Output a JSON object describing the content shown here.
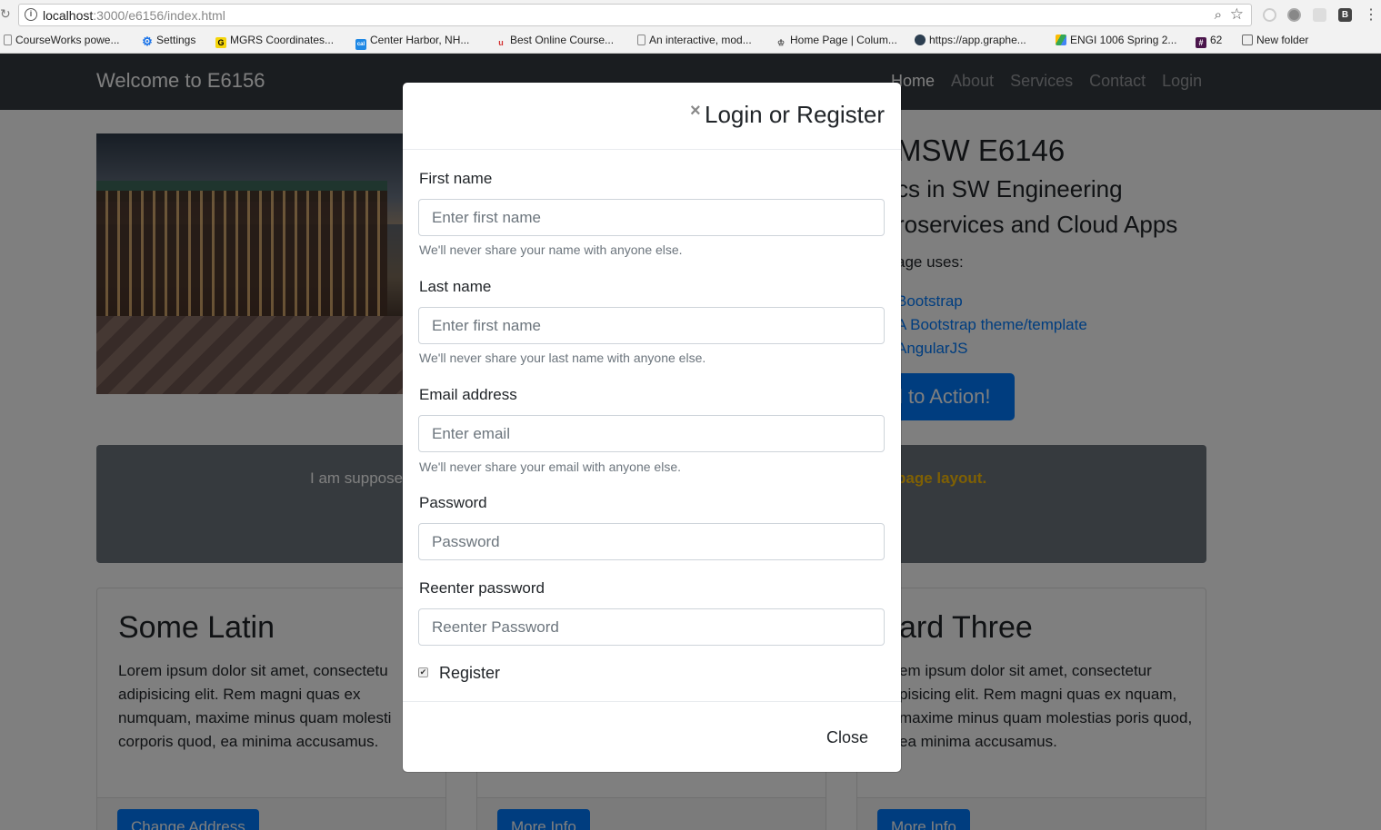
{
  "browser": {
    "url_host": "localhost",
    "url_path": ":3000/e6156/index.html",
    "bookmarks": [
      {
        "label": "CourseWorks powe...",
        "icon": "doc-icon"
      },
      {
        "label": "Settings",
        "icon": "gear-icon"
      },
      {
        "label": "MGRS Coordinates...",
        "icon": "gq-icon"
      },
      {
        "label": "Center Harbor, NH...",
        "icon": "cal-icon"
      },
      {
        "label": "Best Online Course...",
        "icon": "u-icon"
      },
      {
        "label": "An interactive, mod...",
        "icon": "doc-icon"
      },
      {
        "label": "Home Page | Colum...",
        "icon": "crown-icon"
      },
      {
        "label": "https://app.graphe...",
        "icon": "hex-icon"
      },
      {
        "label": "ENGI 1006 Spring 2...",
        "icon": "drive-icon"
      },
      {
        "label": "62",
        "icon": "slack-icon"
      },
      {
        "label": "New folder",
        "icon": "folder-icon"
      }
    ]
  },
  "navbar": {
    "brand": "Welcome to E6156",
    "links": [
      "Home",
      "About",
      "Services",
      "Contact",
      "Login"
    ]
  },
  "hero": {
    "title": "MSW E6146",
    "subtitle1": "cs in SW Engineering",
    "subtitle2": "roservices and Cloud Apps",
    "uses": "age uses:",
    "list": [
      "Bootstrap",
      "A Bootstrap theme/template",
      "AngularJS"
    ],
    "cta": "l to Action!"
  },
  "banner": {
    "left_text": "I am suppose",
    "right_text": "page layout."
  },
  "cards": [
    {
      "title": "Some Latin",
      "body": "Lorem ipsum dolor sit amet, consectetu adipisicing elit. Rem magni quas ex numquam, maxime minus quam molesti corporis quod, ea minima accusamus.",
      "button": "Change Address"
    },
    {
      "title": "",
      "body": "",
      "button": "More Info"
    },
    {
      "title": "ard Three",
      "body": "em ipsum dolor sit amet, consectetur pisicing elit. Rem magni quas ex nquam, maxime minus quam molestias poris quod, ea minima accusamus.",
      "button": "More Info"
    }
  ],
  "modal": {
    "title": "Login or Register",
    "close_x": "×",
    "first_name": {
      "label": "First name",
      "placeholder": "Enter first name",
      "help": "We'll never share your name with anyone else."
    },
    "last_name": {
      "label": "Last name",
      "placeholder": "Enter first name",
      "help": "We'll never share your last name with anyone else."
    },
    "email": {
      "label": "Email address",
      "placeholder": "Enter email",
      "help": "We'll never share your email with anyone else."
    },
    "password": {
      "label": "Password",
      "placeholder": "Password"
    },
    "reenter": {
      "label": "Reenter password",
      "placeholder": "Reenter Password"
    },
    "register_label": "Register",
    "register_checked": true,
    "close_button": "Close"
  }
}
